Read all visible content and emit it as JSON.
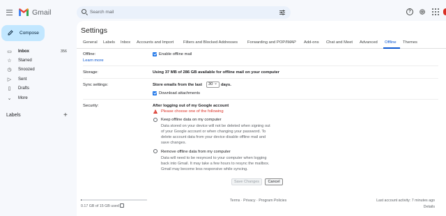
{
  "app": {
    "name": "Gmail"
  },
  "search": {
    "placeholder": "Search mail"
  },
  "compose": {
    "label": "Compose"
  },
  "sidebar": {
    "items": [
      {
        "label": "Inbox",
        "count": "356",
        "icon": "inbox-icon"
      },
      {
        "label": "Starred",
        "count": "",
        "icon": "star-icon"
      },
      {
        "label": "Snoozed",
        "count": "",
        "icon": "clock-icon"
      },
      {
        "label": "Sent",
        "count": "",
        "icon": "send-icon"
      },
      {
        "label": "Drafts",
        "count": "",
        "icon": "draft-icon"
      },
      {
        "label": "More",
        "count": "",
        "icon": "chevron-down-icon"
      }
    ],
    "labels_heading": "Labels"
  },
  "settings": {
    "title": "Settings",
    "tabs": [
      "General",
      "Labels",
      "Inbox",
      "Accounts and Import",
      "Filters and Blocked Addresses",
      "Forwarding and POP/IMAP",
      "Add-ons",
      "Chat and Meet",
      "Advanced",
      "Offline",
      "Themes"
    ],
    "active_tab": "Offline",
    "offline": {
      "label": "Offline:",
      "learn_more": "Learn more",
      "enable_label": "Enable offline mail"
    },
    "storage": {
      "label": "Storage:",
      "text": "Using 37 MB of 286 GB available for offline mail on your computer"
    },
    "sync": {
      "label": "Sync settings:",
      "prefix": "Store emails from the last",
      "days_value": "30",
      "suffix": "days.",
      "attachments_label": "Download attachments"
    },
    "security": {
      "label": "Security:",
      "heading": "After logging out of my Google account",
      "warning": "Please choose one of the following",
      "keep_title": "Keep offline data on my computer",
      "keep_lines": [
        "Data stored on your device will not be deleted when signing out",
        "of your Google account or when changing your password. To",
        "delete account data from your device disable offline mail and",
        "save changes."
      ],
      "remove_title": "Remove offline data from my computer",
      "remove_lines": [
        "Data will need to be resynced to your computer when logging",
        "back into Gmail. It may take a few hours to resync the mailbox.",
        "Gmail may become less responsive while syncing."
      ]
    },
    "buttons": {
      "save": "Save Changes",
      "cancel": "Cancel"
    }
  },
  "footer": {
    "storage_text": "0.17 GB of 15 GB used",
    "storage_fraction": 0.011,
    "links": "Terms · Privacy · Program Policies",
    "activity": "Last account activity: 7 minutes ago",
    "details": "Details"
  },
  "colors": {
    "accent": "#0b57d0",
    "compose_bg": "#c2e7ff",
    "warning": "#d93025",
    "background": "#f6f8fc"
  }
}
